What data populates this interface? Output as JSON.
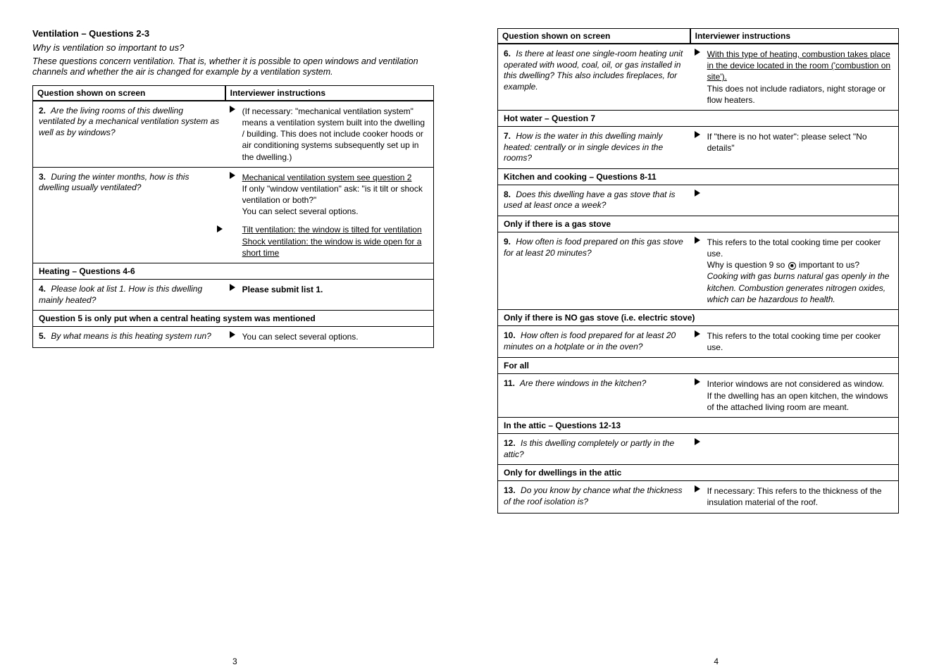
{
  "left": {
    "intro_title": "Ventilation – Questions 2-3",
    "intro_sub": "Why is ventilation so important to us?",
    "intro_text": "These questions concern ventilation. That is, whether it is possible to open windows and ventilation channels and whether the air is changed for example by a ventilation system.",
    "header_left": "Question shown on screen",
    "header_right": "Interviewer instructions",
    "rows": [
      {
        "q_num": "2.",
        "q": "Are the living rooms of this dwelling ventilated by a mechanical ventilation system as well as by windows?",
        "a": "(If necessary: \"mechanical ventilation system\" means a ventilation system built into the dwelling / building. This does not include cooker hoods or air conditioning systems subsequently set up in the dwelling.)"
      },
      {
        "q_num": "3.",
        "q": "During the winter months, how is this dwelling usually ventilated?",
        "a_parts": [
          {
            "type": "link",
            "text": "Mechanical ventilation system see question 2"
          },
          {
            "type": "plain",
            "text": "If only \"window ventilation\" ask: \"is it tilt or shock ventilation or both?\""
          },
          {
            "type": "plain",
            "text": "You can select several options."
          },
          {
            "type": "link",
            "text": "Tilt ventilation: the window is tilted for ventilation"
          },
          {
            "type": "link",
            "text": "Shock ventilation: the window is wide open for a short time"
          }
        ]
      }
    ],
    "sub1": {
      "title": "Heating – Questions 4-6",
      "rows": [
        {
          "q_num": "4.",
          "q": "Please look at list 1. How is this dwelling mainly heated?",
          "a": "Please submit list 1."
        }
      ]
    },
    "sub2": {
      "title": "Question 5 is only put when a central heating system was mentioned",
      "rows": [
        {
          "q_num": "5.",
          "q": "By what means is this heating system run?",
          "a": "You can select several options."
        }
      ]
    }
  },
  "right": {
    "header_left": "Question shown on screen",
    "header_right": "Interviewer instructions",
    "rows": [
      {
        "q_num": "6.",
        "q": "Is there at least one single-room heating unit operated with wood, coal, oil, or gas installed in this dwelling? This also includes fireplaces, for example.",
        "a_parts": [
          {
            "type": "link",
            "text": "With this type of heating, combustion takes place in the device located in the room ('combustion on site')."
          },
          {
            "type": "plain",
            "text": "This does not include radiators, night storage or flow heaters."
          }
        ]
      }
    ],
    "sub_hot": {
      "title": "Hot water – Question 7",
      "rows": [
        {
          "q_num": "7.",
          "q": "How is the water in this dwelling mainly heated: centrally or in single devices in the rooms?",
          "a": "If \"there is no hot water\": please select \"No details\""
        }
      ]
    },
    "sub_cook": {
      "title": "Kitchen and cooking – Questions 8-11",
      "rows": [
        {
          "q_num": "8.",
          "q": "Does this dwelling have a gas stove that is used at least once a week?",
          "a": ""
        }
      ]
    },
    "sub_q9": {
      "title": "Only if there is a gas stove",
      "rows": [
        {
          "q_num": "9.",
          "q": "How often is food prepared on this gas stove for at least 20 minutes?",
          "a_parts": [
            {
              "type": "plain",
              "text": "This refers to the total cooking time per cooker use."
            },
            {
              "type": "plain_icon",
              "text_before": "Why is question 9 so ",
              "icon": true,
              "text_after": " important to us?"
            },
            {
              "type": "italic",
              "text": "Cooking with gas burns natural gas openly in the kitchen. Combustion generates nitrogen oxides, which can be hazardous to health."
            }
          ]
        }
      ]
    },
    "sub_q10": {
      "title": "Only if there is NO gas stove (i.e. electric stove)",
      "rows": [
        {
          "q_num": "10.",
          "q": "How often is food prepared for at least 20 minutes on a hotplate or in the oven?",
          "a": "This refers to the total cooking time per cooker use."
        }
      ]
    },
    "sub_q11": {
      "title": "For all",
      "rows": [
        {
          "q_num": "11.",
          "q": "Are there windows in the kitchen?",
          "a_parts": [
            {
              "type": "plain",
              "text": "Interior windows are not considered as window."
            },
            {
              "type": "plain",
              "text": "If the dwelling has an open kitchen, the windows of the attached living room are meant."
            }
          ]
        }
      ]
    },
    "sub_attic": {
      "title": "In the attic – Questions 12-13",
      "rows": [
        {
          "q_num": "12.",
          "q": "Is this dwelling completely or partly in the attic?",
          "a": ""
        }
      ]
    },
    "sub_q13": {
      "title": "Only for dwellings in the attic",
      "rows": [
        {
          "q_num": "13.",
          "q": "Do you know by chance what the thickness of the roof isolation is?",
          "a": "If necessary: This refers to the thickness of the insulation material of the roof."
        }
      ]
    }
  },
  "page_left": "3",
  "page_right": "4"
}
